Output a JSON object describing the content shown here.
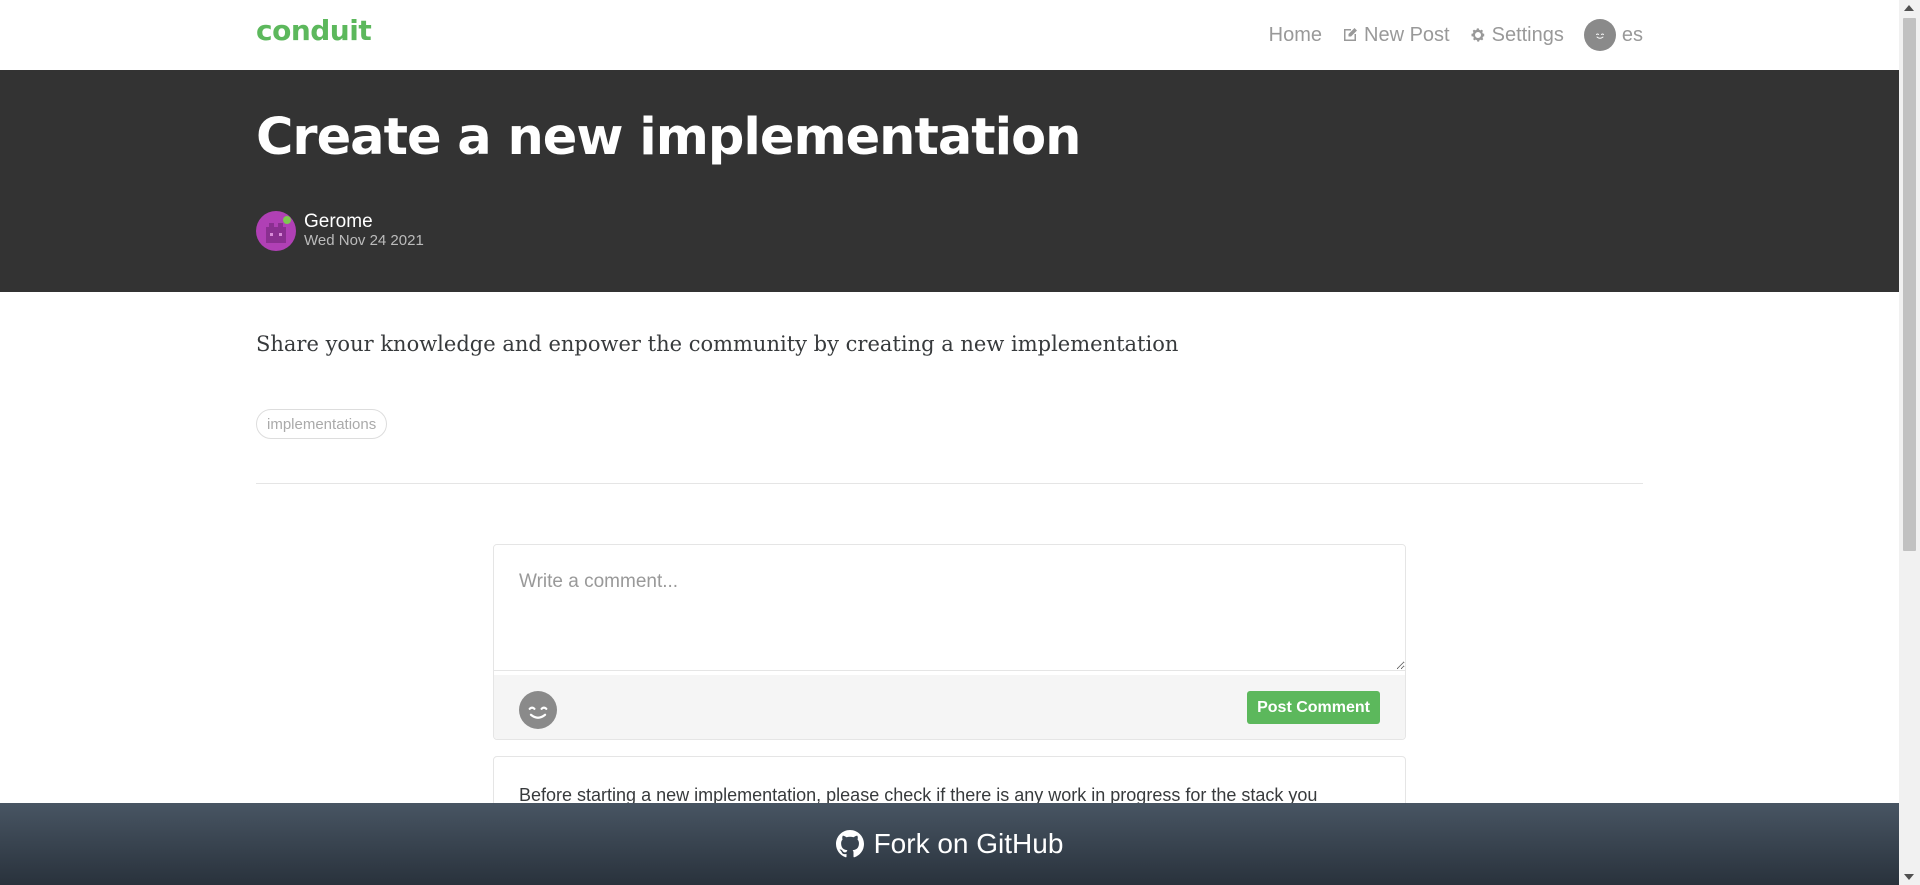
{
  "navbar": {
    "brand": "conduit",
    "home": "Home",
    "new_post": "New Post",
    "settings": "Settings",
    "username": "es"
  },
  "article": {
    "title": "Create a new implementation",
    "author": "Gerome",
    "date": "Wed Nov 24 2021",
    "body": "Share your knowledge and enpower the community by creating a new implementation",
    "tags": [
      "implementations"
    ]
  },
  "comment_form": {
    "placeholder": "Write a comment...",
    "submit_label": "Post Comment"
  },
  "comments": [
    {
      "body": "Before starting a new implementation, please check if there is any work in progress for the stack you"
    }
  ],
  "footer": {
    "github_label": "Fork on GitHub"
  },
  "colors": {
    "brand": "#5cb85c",
    "banner": "#333333"
  }
}
